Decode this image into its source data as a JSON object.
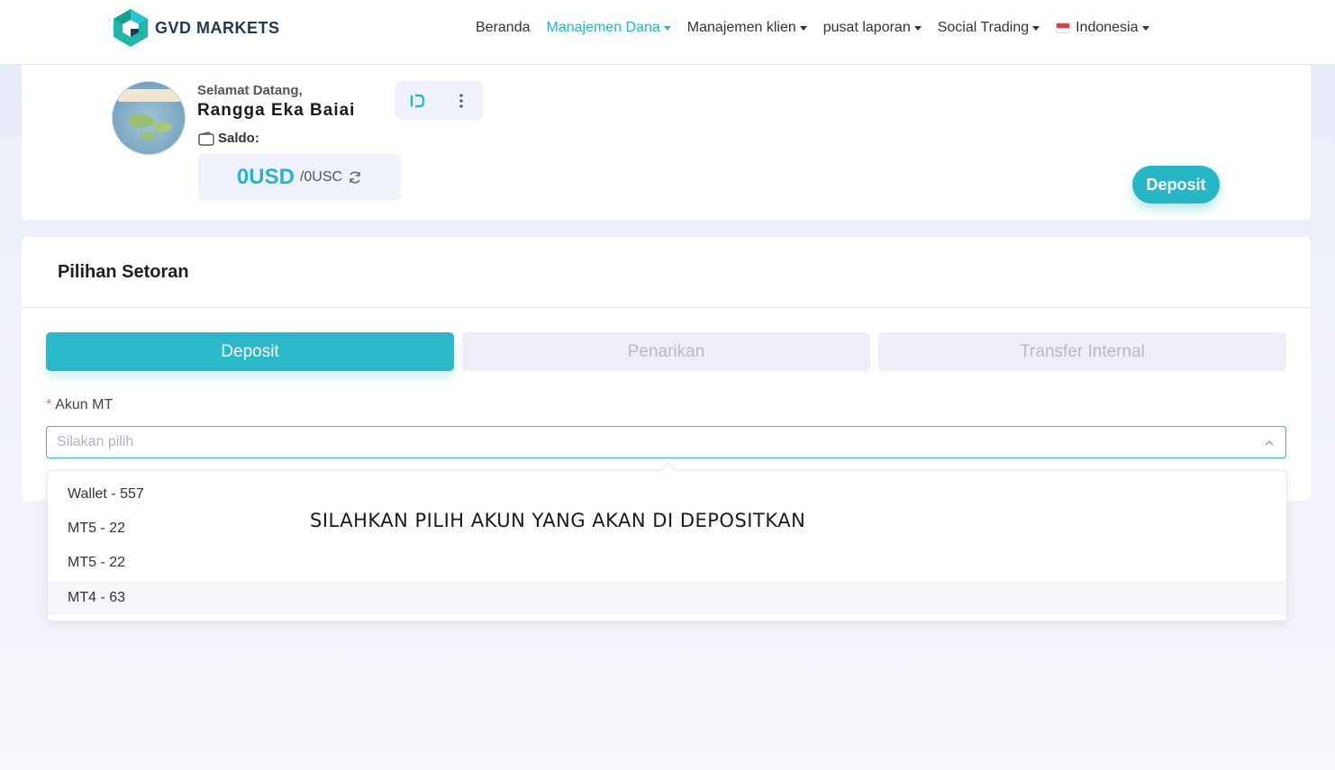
{
  "brand": {
    "name": "GVD MARKETS",
    "accent": "#26b7c7"
  },
  "nav": {
    "items": [
      {
        "label": "Beranda",
        "active": false,
        "dropdown": false
      },
      {
        "label": "Manajemen Dana",
        "active": true,
        "dropdown": true
      },
      {
        "label": "Manajemen klien",
        "active": false,
        "dropdown": true
      },
      {
        "label": "pusat laporan",
        "active": false,
        "dropdown": true
      },
      {
        "label": "Social Trading",
        "active": false,
        "dropdown": true
      }
    ],
    "language": {
      "label": "Indonesia",
      "icon": "indonesia-flag-icon"
    }
  },
  "profile": {
    "welcome": "Selamat Datang,",
    "name": "Rangga Eka Baiai",
    "saldo_label": "Saldo:",
    "balance_main": "0USD",
    "balance_sub": "/0USC",
    "deposit_button": "Deposit"
  },
  "form": {
    "title": "Pilihan Setoran",
    "tabs": [
      {
        "label": "Deposit",
        "active": true
      },
      {
        "label": "Penarikan",
        "active": false
      },
      {
        "label": "Transfer Internal",
        "active": false
      }
    ],
    "field_label": "Akun MT",
    "placeholder": "Silakan pilih"
  },
  "dropdown": {
    "options": [
      {
        "label": "Wallet - 557"
      },
      {
        "label": "MT5 - 22"
      },
      {
        "label": "MT5 - 22"
      },
      {
        "label": "MT4 - 63"
      }
    ]
  },
  "annotation": "SILAHKAN PILIH AKUN YANG AKAN DI DEPOSITKAN"
}
